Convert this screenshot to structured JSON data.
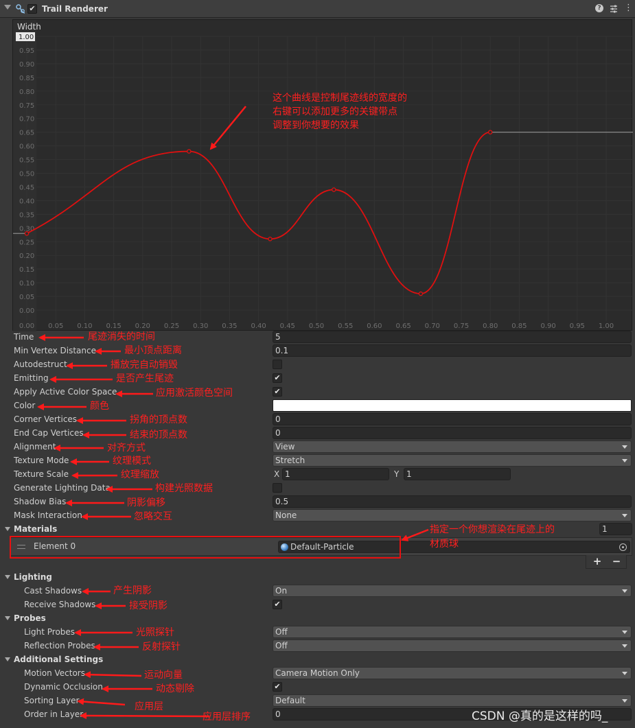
{
  "component": {
    "title": "Trail Renderer",
    "enabled_check": "✔",
    "help_icon": "?",
    "more_icon": "⋮"
  },
  "curve": {
    "title": "Width",
    "ymax_label": "1.00",
    "y_ticks": [
      "0.95",
      "0.90",
      "0.85",
      "0.80",
      "0.75",
      "0.70",
      "0.65",
      "0.60",
      "0.55",
      "0.50",
      "0.45",
      "0.40",
      "0.35",
      "0.30",
      "0.25",
      "0.20",
      "0.15",
      "0.10",
      "0.05",
      "0.00"
    ],
    "x_ticks": [
      "0.00",
      "0.05",
      "0.10",
      "0.15",
      "0.20",
      "0.25",
      "0.30",
      "0.35",
      "0.40",
      "0.45",
      "0.50",
      "0.55",
      "0.60",
      "0.65",
      "0.70",
      "0.75",
      "0.80",
      "0.85",
      "0.90",
      "0.95",
      "1.00"
    ],
    "keys": [
      {
        "t": 0.0,
        "v": 0.28
      },
      {
        "t": 0.28,
        "v": 0.58
      },
      {
        "t": 0.42,
        "v": 0.26
      },
      {
        "t": 0.53,
        "v": 0.44
      },
      {
        "t": 0.68,
        "v": 0.06
      },
      {
        "t": 0.8,
        "v": 0.65
      }
    ],
    "curve_color": "#e01010"
  },
  "props": {
    "time": {
      "label": "Time",
      "value": "5"
    },
    "min_vertex": {
      "label": "Min Vertex Distance",
      "value": "0.1"
    },
    "autodestruct": {
      "label": "Autodestruct",
      "checked": false
    },
    "emitting": {
      "label": "Emitting",
      "checked": true
    },
    "apply_color_space": {
      "label": "Apply Active Color Space",
      "checked": true
    },
    "color": {
      "label": "Color",
      "value": "#ffffff"
    },
    "corner_vertices": {
      "label": "Corner Vertices",
      "value": "0"
    },
    "end_cap_vertices": {
      "label": "End Cap Vertices",
      "value": "0"
    },
    "alignment": {
      "label": "Alignment",
      "value": "View"
    },
    "texture_mode": {
      "label": "Texture Mode",
      "value": "Stretch"
    },
    "texture_scale": {
      "label": "Texture Scale",
      "x_label": "X",
      "x": "1",
      "y_label": "Y",
      "y": "1"
    },
    "gen_lighting": {
      "label": "Generate Lighting Data",
      "checked": false
    },
    "shadow_bias": {
      "label": "Shadow Bias",
      "value": "0.5"
    },
    "mask_interaction": {
      "label": "Mask Interaction",
      "value": "None"
    }
  },
  "materials": {
    "header": "Materials",
    "size": "1",
    "element_label": "Element 0",
    "material_name": "Default-Particle",
    "add": "+",
    "remove": "−"
  },
  "lighting": {
    "header": "Lighting",
    "cast_shadows": {
      "label": "Cast Shadows",
      "value": "On"
    },
    "receive_shadows": {
      "label": "Receive Shadows",
      "checked": true
    }
  },
  "probes": {
    "header": "Probes",
    "light_probes": {
      "label": "Light Probes",
      "value": "Off"
    },
    "reflection_probes": {
      "label": "Reflection Probes",
      "value": "Off"
    }
  },
  "additional": {
    "header": "Additional Settings",
    "motion_vectors": {
      "label": "Motion Vectors",
      "value": "Camera Motion Only"
    },
    "dynamic_occlusion": {
      "label": "Dynamic Occlusion",
      "checked": true
    },
    "sorting_layer": {
      "label": "Sorting Layer",
      "value": "Default"
    },
    "order_in_layer": {
      "label": "Order in Layer",
      "value": "0"
    }
  },
  "annotations": {
    "curve_note_1": "这个曲线是控制尾迹线的宽度的",
    "curve_note_2": "右键可以添加更多的关键带点",
    "curve_note_3": "调整到你想要的效果",
    "time": "尾迹消失的时间",
    "min_vertex": "最小顶点距离",
    "autodestruct": "播放完自动销毁",
    "emitting": "是否产生尾迹",
    "apply_color_space": "应用激活颜色空间",
    "color": "颜色",
    "corner_vertices": "拐角的顶点数",
    "end_cap_vertices": "结束的顶点数",
    "alignment": "对齐方式",
    "texture_mode": "纹理模式",
    "texture_scale": "纹理缩放",
    "gen_lighting": "构建光照数据",
    "shadow_bias": "阴影偏移",
    "mask_interaction": "忽略交互",
    "materials_1": "指定一个你想渲染在尾迹上的",
    "materials_2": "材质球",
    "cast_shadows": "产生阴影",
    "receive_shadows": "接受阴影",
    "light_probes": "光照探针",
    "reflection_probes": "反射探针",
    "motion_vectors": "运动向量",
    "dynamic_occlusion": "动态剔除",
    "sorting_layer": "应用层",
    "order_in_layer": "应用层排序",
    "color_hex": "#ff2020"
  },
  "watermark": "CSDN @真的是这样的吗_"
}
